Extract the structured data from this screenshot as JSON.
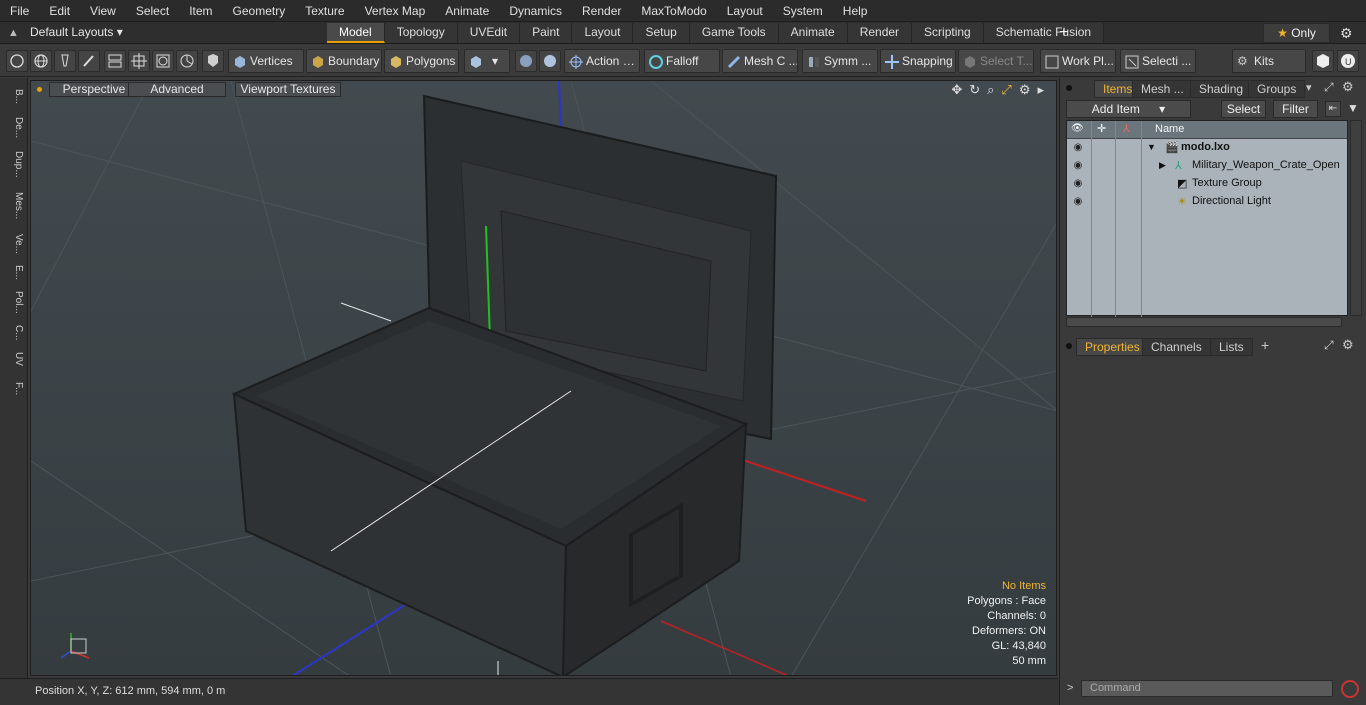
{
  "menubar": {
    "items": [
      "File",
      "Edit",
      "View",
      "Select",
      "Item",
      "Geometry",
      "Texture",
      "Vertex Map",
      "Animate",
      "Dynamics",
      "Render",
      "MaxToModo",
      "Layout",
      "System",
      "Help"
    ]
  },
  "layoutbar": {
    "layout_label": "Default Layouts",
    "tabs": [
      "Model",
      "Topology",
      "UVEdit",
      "Paint",
      "Layout",
      "Setup",
      "Game Tools",
      "Animate",
      "Render",
      "Scripting",
      "Schematic Fusion"
    ],
    "active_tab": "Model",
    "only_label": "Only"
  },
  "toolbar": {
    "vertices": "Vertices",
    "boundary": "Boundary",
    "polygons": "Polygons",
    "action": "Action",
    "falloff": "Falloff",
    "meshc": "Mesh C ...",
    "symm": "Symm ...",
    "snapping": "Snapping",
    "selectt": "Select T...",
    "workpl": "Work Pl...",
    "selecti": "Selecti ...",
    "kits": "Kits"
  },
  "leftstrip": {
    "tabs": [
      "B...",
      "De...",
      "Dup...",
      "Mes...",
      "Ve...",
      "E...",
      "Pol...",
      "C...",
      "UV",
      "F..."
    ]
  },
  "viewport": {
    "buttons": [
      "Perspective",
      "Advanced",
      "Viewport Textures"
    ],
    "stats": {
      "no_items": "No Items",
      "polygons": "Polygons : Face",
      "channels": "Channels: 0",
      "deformers": "Deformers: ON",
      "gl": "GL: 43,840",
      "scale": "50 mm"
    }
  },
  "statusbar": {
    "position": "Position X, Y, Z:   612 mm, 594 mm, 0 m"
  },
  "items_panel": {
    "tabs": [
      "Items",
      "Mesh ...",
      "Shading",
      "Groups"
    ],
    "active_tab": "Items",
    "add_item": "Add Item",
    "select": "Select",
    "filter": "Filter",
    "name_header": "Name",
    "rows": [
      "modo.lxo",
      "Military_Weapon_Crate_Open",
      "Texture Group",
      "Directional Light"
    ]
  },
  "props_panel": {
    "tabs": [
      "Properties",
      "Channels",
      "Lists"
    ],
    "active_tab": "Properties"
  },
  "command": {
    "placeholder": "Command"
  }
}
